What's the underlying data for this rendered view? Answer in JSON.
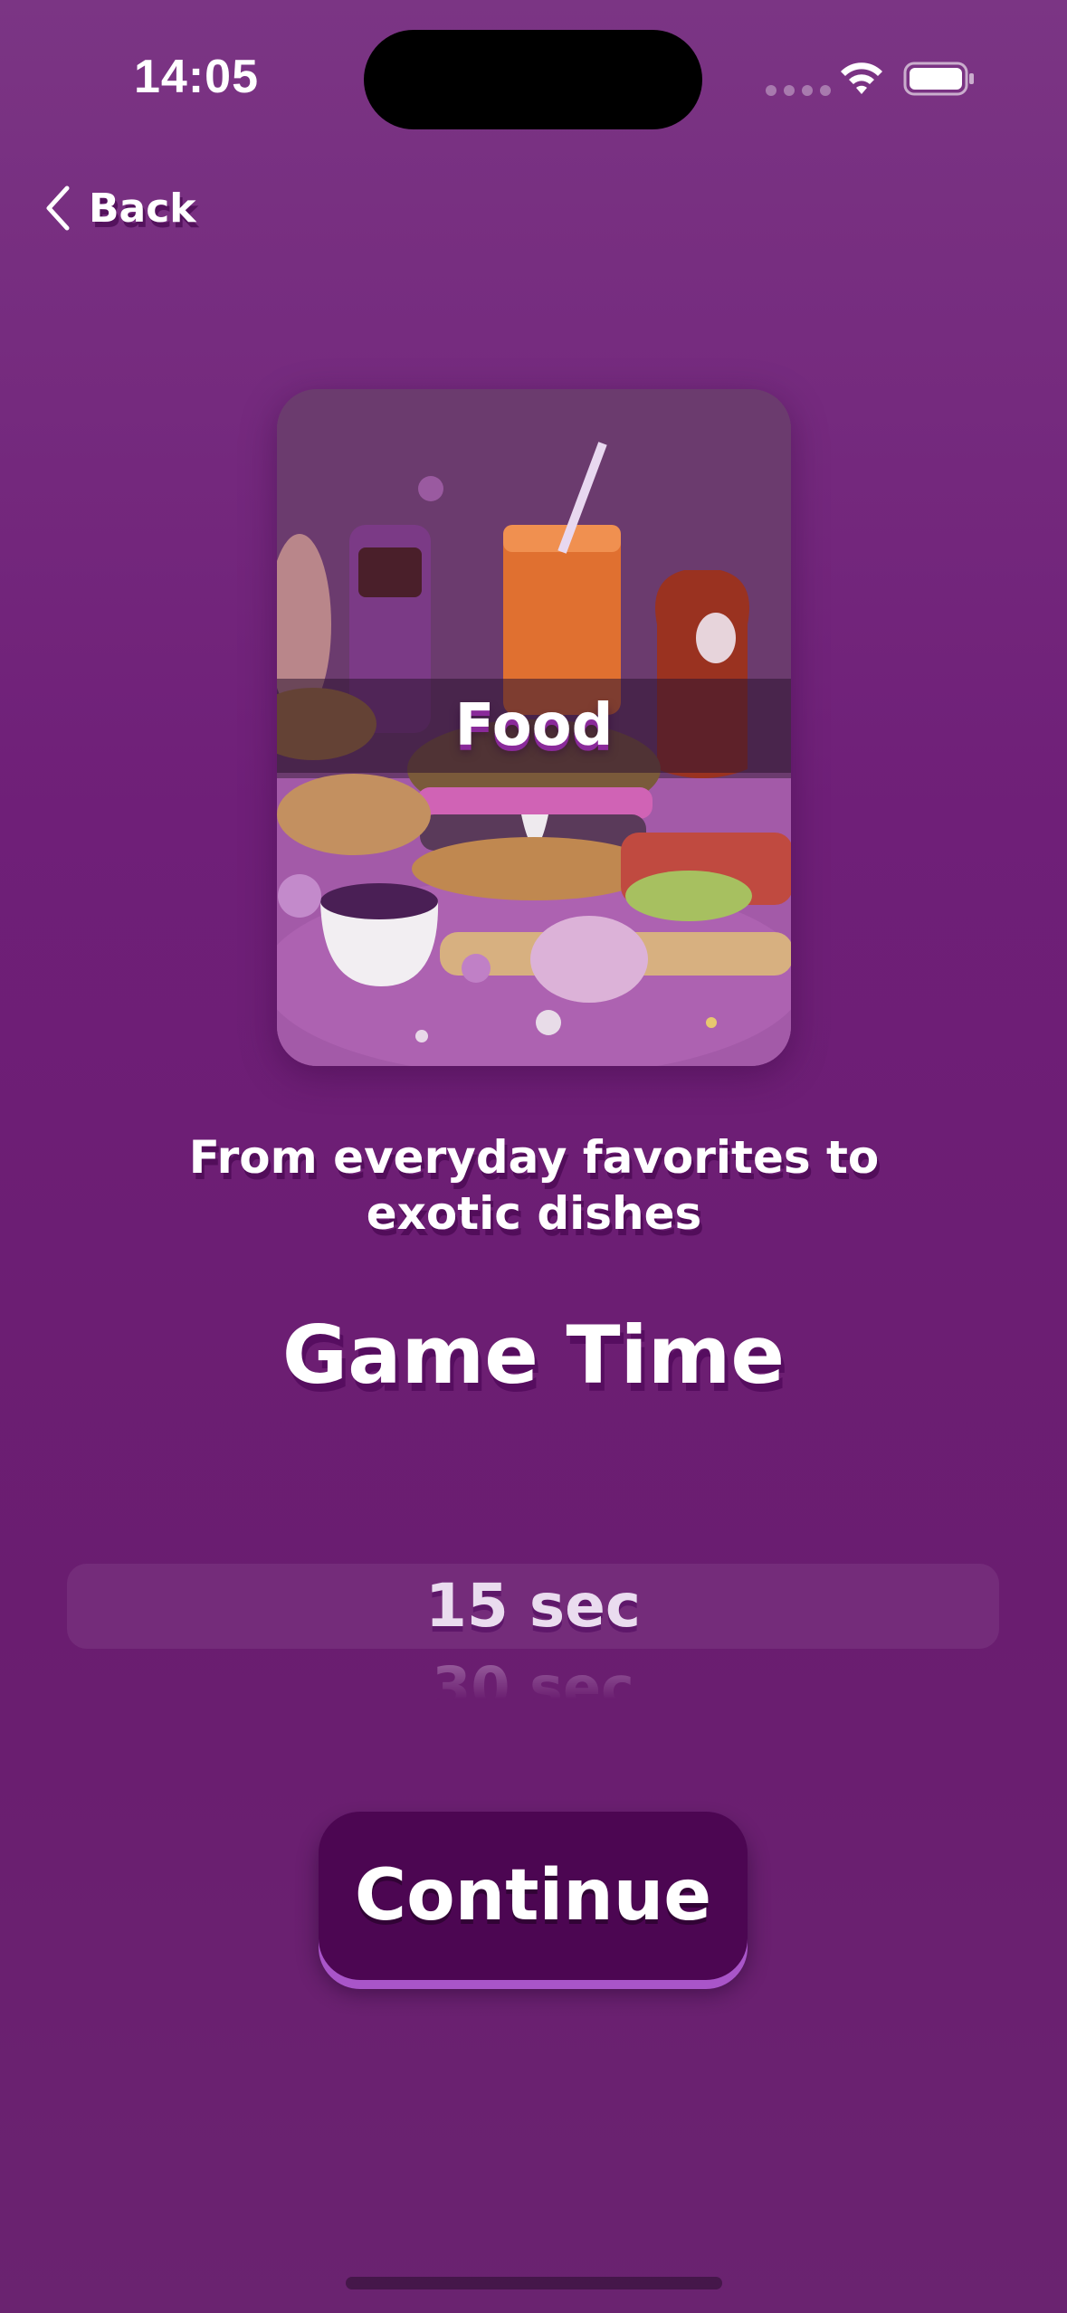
{
  "status_bar": {
    "time": "14:05",
    "icons": [
      "signal-dots-icon",
      "wifi-icon",
      "battery-icon"
    ]
  },
  "nav": {
    "back_label": "Back",
    "back_icon": "chevron-left-icon"
  },
  "category_card": {
    "title": "Food",
    "image_subject": "food-illustration"
  },
  "description": "From everyday favorites to exotic dishes",
  "game_time": {
    "heading": "Game Time",
    "picker": {
      "selected": "15 sec",
      "next": "30 sec"
    }
  },
  "continue_button": {
    "label": "Continue"
  },
  "colors": {
    "background": "#6f1f78",
    "button": "#4c0652",
    "button_edge": "#a955c9"
  }
}
